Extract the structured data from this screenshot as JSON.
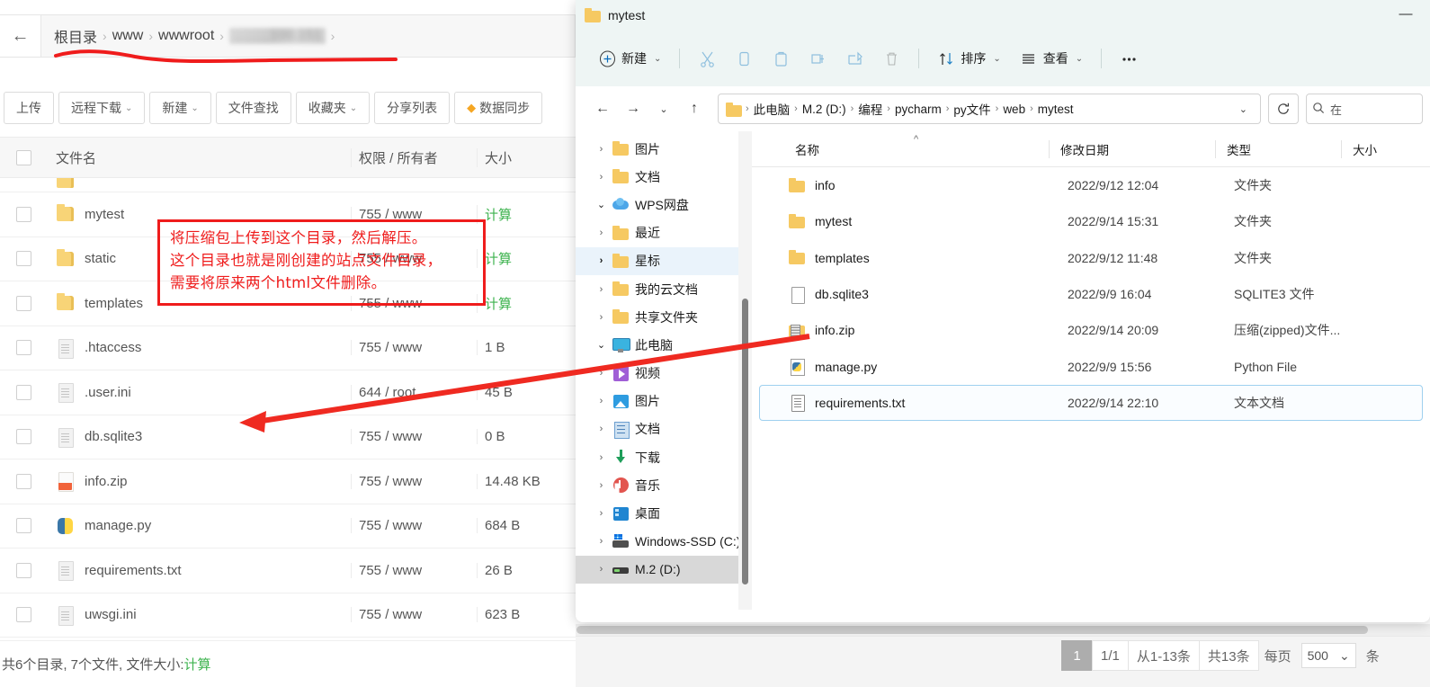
{
  "baota": {
    "breadcrumb": {
      "back_icon": "back-arrow-icon",
      "items": [
        "根目录",
        "www",
        "wwwroot",
        "……..100.151"
      ],
      "separator": "›"
    },
    "toolbar": [
      {
        "label": "上传",
        "caret": false,
        "icon": null
      },
      {
        "label": "远程下载",
        "caret": true,
        "icon": null
      },
      {
        "label": "新建",
        "caret": true,
        "icon": null
      },
      {
        "label": "文件查找",
        "caret": false,
        "icon": null
      },
      {
        "label": "收藏夹",
        "caret": true,
        "icon": null
      },
      {
        "label": "分享列表",
        "caret": false,
        "icon": null
      },
      {
        "label": "数据同步",
        "caret": false,
        "icon": "diamond-icon"
      }
    ],
    "columns": {
      "name": "文件名",
      "perm": "权限 / 所有者",
      "size": "大小"
    },
    "rows": [
      {
        "name": "",
        "icon": "folder",
        "perm": "",
        "size": "",
        "partial": true
      },
      {
        "name": "mytest",
        "icon": "folder",
        "perm": "755 / www",
        "size": "计算",
        "size_is_link": true
      },
      {
        "name": "static",
        "icon": "folder",
        "perm": "755 / www",
        "size": "计算",
        "size_is_link": true
      },
      {
        "name": "templates",
        "icon": "folder",
        "perm": "755 / www",
        "size": "计算",
        "size_is_link": true
      },
      {
        "name": ".htaccess",
        "icon": "file",
        "perm": "755 / www",
        "size": "1 B"
      },
      {
        "name": ".user.ini",
        "icon": "file",
        "perm": "644 / root",
        "size": "45 B"
      },
      {
        "name": "db.sqlite3",
        "icon": "file",
        "perm": "755 / www",
        "size": "0 B"
      },
      {
        "name": "info.zip",
        "icon": "zip",
        "perm": "755 / www",
        "size": "14.48 KB"
      },
      {
        "name": "manage.py",
        "icon": "py",
        "perm": "755 / www",
        "size": "684 B"
      },
      {
        "name": "requirements.txt",
        "icon": "file",
        "perm": "755 / www",
        "size": "26 B"
      },
      {
        "name": "uwsgi.ini",
        "icon": "file",
        "perm": "755 / www",
        "size": "623 B"
      }
    ],
    "footer": {
      "prefix": "共6个目录, 7个文件, 文件大小: ",
      "calc_link": "计算"
    },
    "pager": {
      "current_page": "1",
      "page_of": "1/1",
      "range": "从1-13条",
      "total": "共13条",
      "per_page_label": "每页",
      "per_page_value": "500",
      "per_page_caret": "⌄",
      "unit": "条"
    }
  },
  "annotation": {
    "lines": [
      "将压缩包上传到这个目录，然后解压。",
      "这个目录也就是刚创建的站点文件目录，",
      "需要将原来两个html文件删除。"
    ],
    "color": "#ef1c1c"
  },
  "explorer": {
    "title": "mytest",
    "title_icon": "folder-icon",
    "minimize_label": "—",
    "toolbar": [
      {
        "name": "new",
        "label": "新建",
        "icon": "plus-circle-icon",
        "caret": true,
        "dim": false
      },
      {
        "name": "cut",
        "label": "",
        "icon": "scissors-icon",
        "caret": false,
        "dim": true
      },
      {
        "name": "copy",
        "label": "",
        "icon": "copy-icon",
        "caret": false,
        "dim": true
      },
      {
        "name": "paste",
        "label": "",
        "icon": "paste-icon",
        "caret": false,
        "dim": true
      },
      {
        "name": "rename",
        "label": "",
        "icon": "rename-icon",
        "caret": false,
        "dim": true
      },
      {
        "name": "share",
        "label": "",
        "icon": "share-icon",
        "caret": false,
        "dim": true
      },
      {
        "name": "delete",
        "label": "",
        "icon": "trash-icon",
        "caret": false,
        "dim": true
      },
      {
        "name": "sort",
        "label": "排序",
        "icon": "sort-icon",
        "caret": true,
        "dim": false
      },
      {
        "name": "view",
        "label": "查看",
        "icon": "view-list-icon",
        "caret": true,
        "dim": false
      },
      {
        "name": "more",
        "label": "",
        "icon": "ellipsis-icon",
        "caret": false,
        "dim": false
      }
    ],
    "nav": {
      "back_icon": "arrow-left-icon",
      "forward_icon": "arrow-right-icon",
      "recent_icon": "chevron-down-icon",
      "up_icon": "arrow-up-icon",
      "refresh_icon": "refresh-icon",
      "address_caret": "⌄",
      "address_crumbs": [
        "此电脑",
        "M.2 (D:)",
        "编程",
        "pycharm",
        "py文件",
        "web",
        "mytest"
      ],
      "address_sep": "›",
      "search_icon": "search-icon",
      "search_text": "在"
    },
    "tree": [
      {
        "label": "图片",
        "icon": "folder",
        "chev": ">",
        "indent": 2,
        "state": "none"
      },
      {
        "label": "文档",
        "icon": "folder",
        "chev": ">",
        "indent": 2,
        "state": "none"
      },
      {
        "label": "WPS网盘",
        "icon": "cloud",
        "chev": "⌄",
        "indent": 1,
        "state": "none"
      },
      {
        "label": "最近",
        "icon": "folder",
        "chev": ">",
        "indent": 2,
        "state": "none"
      },
      {
        "label": "星标",
        "icon": "folder",
        "chev": ">",
        "indent": 2,
        "state": "blue"
      },
      {
        "label": "我的云文档",
        "icon": "folder",
        "chev": ">",
        "indent": 2,
        "state": "none"
      },
      {
        "label": "共享文件夹",
        "icon": "folder",
        "chev": ">",
        "indent": 2,
        "state": "none"
      },
      {
        "label": "此电脑",
        "icon": "pc",
        "chev": "⌄",
        "indent": 1,
        "state": "none"
      },
      {
        "label": "视频",
        "icon": "video",
        "chev": ">",
        "indent": 2,
        "state": "none"
      },
      {
        "label": "图片",
        "icon": "pic",
        "chev": ">",
        "indent": 2,
        "state": "none"
      },
      {
        "label": "文档",
        "icon": "doc",
        "chev": ">",
        "indent": 2,
        "state": "none"
      },
      {
        "label": "下载",
        "icon": "down",
        "chev": ">",
        "indent": 2,
        "state": "none"
      },
      {
        "label": "音乐",
        "icon": "music",
        "chev": ">",
        "indent": 2,
        "state": "none"
      },
      {
        "label": "桌面",
        "icon": "desktop",
        "chev": ">",
        "indent": 2,
        "state": "none"
      },
      {
        "label": "Windows-SSD (C:)",
        "icon": "drivec",
        "chev": ">",
        "indent": 2,
        "state": "none"
      },
      {
        "label": "M.2 (D:)",
        "icon": "drive",
        "chev": ">",
        "indent": 2,
        "state": "gray"
      }
    ],
    "columns": {
      "name": "名称",
      "date": "修改日期",
      "type": "类型",
      "size": "大小"
    },
    "sort_indicator": "^",
    "files": [
      {
        "name": "info",
        "icon": "folder",
        "date": "2022/9/12 12:04",
        "type": "文件夹",
        "size": "",
        "selected": false
      },
      {
        "name": "mytest",
        "icon": "folder",
        "date": "2022/9/14 15:31",
        "type": "文件夹",
        "size": "",
        "selected": false
      },
      {
        "name": "templates",
        "icon": "folder",
        "date": "2022/9/12 11:48",
        "type": "文件夹",
        "size": "",
        "selected": false
      },
      {
        "name": "db.sqlite3",
        "icon": "file",
        "date": "2022/9/9 16:04",
        "type": "SQLITE3 文件",
        "size": "",
        "selected": false
      },
      {
        "name": "info.zip",
        "icon": "zip",
        "date": "2022/9/14 20:09",
        "type": "压缩(zipped)文件...",
        "size": "",
        "selected": false
      },
      {
        "name": "manage.py",
        "icon": "py",
        "date": "2022/9/9 15:56",
        "type": "Python File",
        "size": "",
        "selected": false
      },
      {
        "name": "requirements.txt",
        "icon": "txt",
        "date": "2022/9/14 22:10",
        "type": "文本文档",
        "size": "",
        "selected": true
      }
    ]
  }
}
